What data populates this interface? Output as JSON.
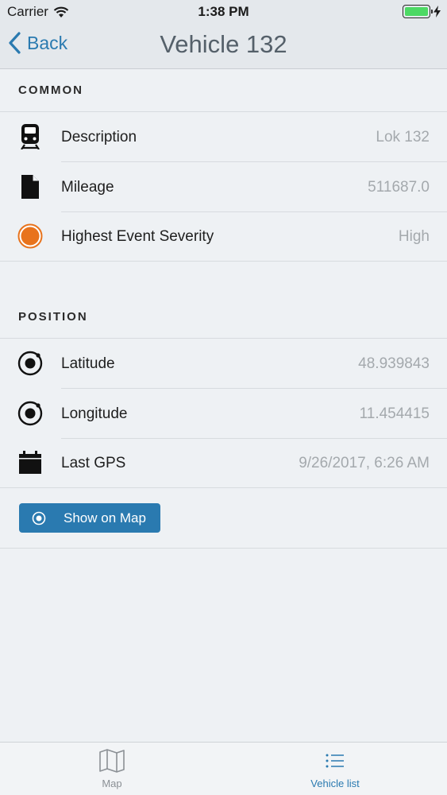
{
  "status_bar": {
    "carrier": "Carrier",
    "time": "1:38 PM",
    "battery_level": 1.0
  },
  "nav": {
    "back_label": "Back",
    "title": "Vehicle 132"
  },
  "sections": {
    "common": {
      "title": "COMMON",
      "rows": [
        {
          "icon": "train-icon",
          "label": "Description",
          "value": "Lok 132"
        },
        {
          "icon": "document-icon",
          "label": "Mileage",
          "value": "511687.0"
        },
        {
          "icon": "severity-dot-icon",
          "label": "Highest Event Severity",
          "value": "High"
        }
      ]
    },
    "position": {
      "title": "POSITION",
      "rows": [
        {
          "icon": "location-target-icon",
          "label": "Latitude",
          "value": "48.939843"
        },
        {
          "icon": "location-target-icon",
          "label": "Longitude",
          "value": "11.454415"
        },
        {
          "icon": "calendar-icon",
          "label": "Last GPS",
          "value": "9/26/2017, 6:26 AM"
        }
      ],
      "button_label": "Show on Map"
    }
  },
  "tab_bar": {
    "tabs": [
      {
        "icon": "map-icon",
        "label": "Map",
        "active": false
      },
      {
        "icon": "list-icon",
        "label": "Vehicle list",
        "active": true
      }
    ]
  },
  "colors": {
    "accent": "#2a7ab0",
    "severity_high": "#e8731c",
    "background": "#eef1f4"
  }
}
